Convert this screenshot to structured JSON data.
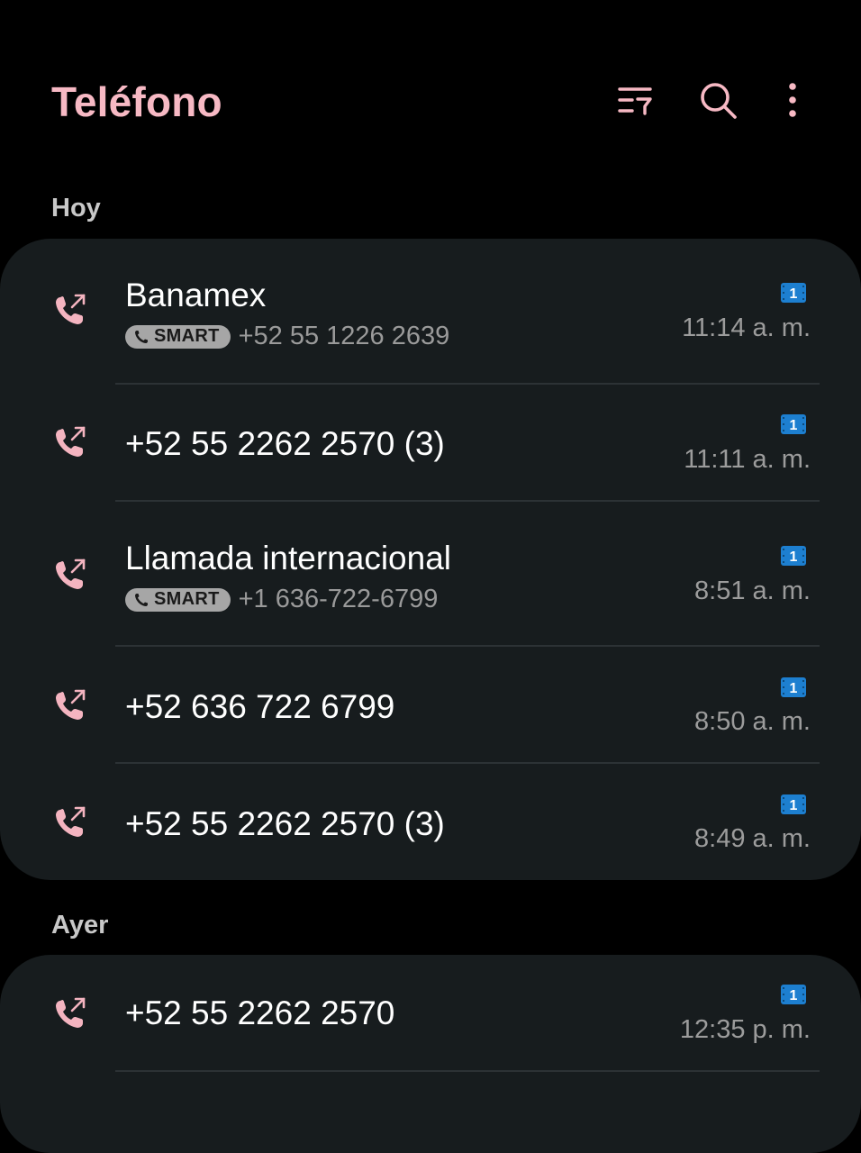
{
  "app": {
    "title": "Teléfono"
  },
  "toolbar": {
    "filter_icon": "filter-list-icon",
    "search_icon": "search-icon",
    "more_icon": "more-vertical-icon"
  },
  "colors": {
    "accent": "#f7b9c4",
    "card_background": "#171c1e",
    "background": "#000000",
    "sim_badge": "#1d7fd0"
  },
  "sections": [
    {
      "label": "Hoy",
      "calls": [
        {
          "name": "Banamex",
          "badge": "SMART",
          "number": "+52 55 1226 2639",
          "sim": "1",
          "time": "11:14 a. m.",
          "type": "outgoing"
        },
        {
          "name": "+52 55 2262 2570 (3)",
          "sim": "1",
          "time": "11:11 a. m.",
          "type": "outgoing"
        },
        {
          "name": "Llamada internacional",
          "badge": "SMART",
          "number": "+1 636-722-6799",
          "sim": "1",
          "time": "8:51 a. m.",
          "type": "outgoing"
        },
        {
          "name": "+52 636 722 6799",
          "sim": "1",
          "time": "8:50 a. m.",
          "type": "outgoing"
        },
        {
          "name": "+52 55 2262 2570 (3)",
          "sim": "1",
          "time": "8:49 a. m.",
          "type": "outgoing"
        }
      ]
    },
    {
      "label": "Ayer",
      "calls": [
        {
          "name": "+52 55 2262 2570",
          "sim": "1",
          "time": "12:35 p. m.",
          "type": "outgoing"
        }
      ]
    }
  ]
}
